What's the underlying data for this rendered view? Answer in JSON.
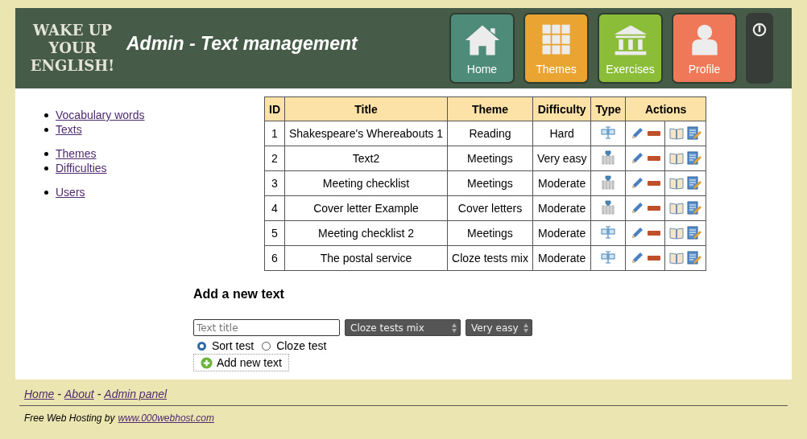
{
  "logo": {
    "lines": [
      "WAKE UP",
      "YOUR",
      "ENGLISH!"
    ]
  },
  "page_title": "Admin - Text management",
  "nav_tiles": [
    {
      "label": "Home",
      "kind": "home",
      "color": "#4e8b78"
    },
    {
      "label": "Themes",
      "kind": "grid",
      "color": "#e9a432"
    },
    {
      "label": "Exercises",
      "kind": "building",
      "color": "#8cbd38"
    },
    {
      "label": "Profile",
      "kind": "person",
      "color": "#ef7858"
    }
  ],
  "sidebar": {
    "groups": [
      [
        "Vocabulary words",
        "Texts"
      ],
      [
        "Themes",
        "Difficulties"
      ],
      [
        "Users"
      ]
    ]
  },
  "table": {
    "columns": [
      "ID",
      "Title",
      "Theme",
      "Difficulty",
      "Type",
      "Actions"
    ],
    "rows": [
      {
        "id": "1",
        "title": "Shakespeare's Whereabouts 1",
        "theme": "Reading",
        "difficulty": "Hard",
        "kind": "sort"
      },
      {
        "id": "2",
        "title": "Text2",
        "theme": "Meetings",
        "difficulty": "Very easy",
        "kind": "cloze"
      },
      {
        "id": "3",
        "title": "Meeting checklist",
        "theme": "Meetings",
        "difficulty": "Moderate",
        "kind": "cloze"
      },
      {
        "id": "4",
        "title": "Cover letter Example",
        "theme": "Cover letters",
        "difficulty": "Moderate",
        "kind": "cloze"
      },
      {
        "id": "5",
        "title": "Meeting checklist 2",
        "theme": "Meetings",
        "difficulty": "Moderate",
        "kind": "sort"
      },
      {
        "id": "6",
        "title": "The postal service",
        "theme": "Cloze tests mix",
        "difficulty": "Moderate",
        "kind": "sort"
      }
    ]
  },
  "add_form": {
    "heading": "Add a new text",
    "title_field": {
      "placeholder": "Text title"
    },
    "theme_select": "Cloze tests mix",
    "difficulty_select": "Very easy",
    "radios": [
      {
        "label": "Sort test",
        "selected": true
      },
      {
        "label": "Cloze test",
        "selected": false
      }
    ],
    "submit": "Add new text"
  },
  "footer": {
    "links": [
      {
        "label": "Home"
      },
      {
        "label": "About"
      },
      {
        "label": "Admin panel"
      }
    ],
    "separator": "-",
    "hosting_text": "Free Web Hosting by",
    "hosting_link": "www.000webhost.com"
  }
}
